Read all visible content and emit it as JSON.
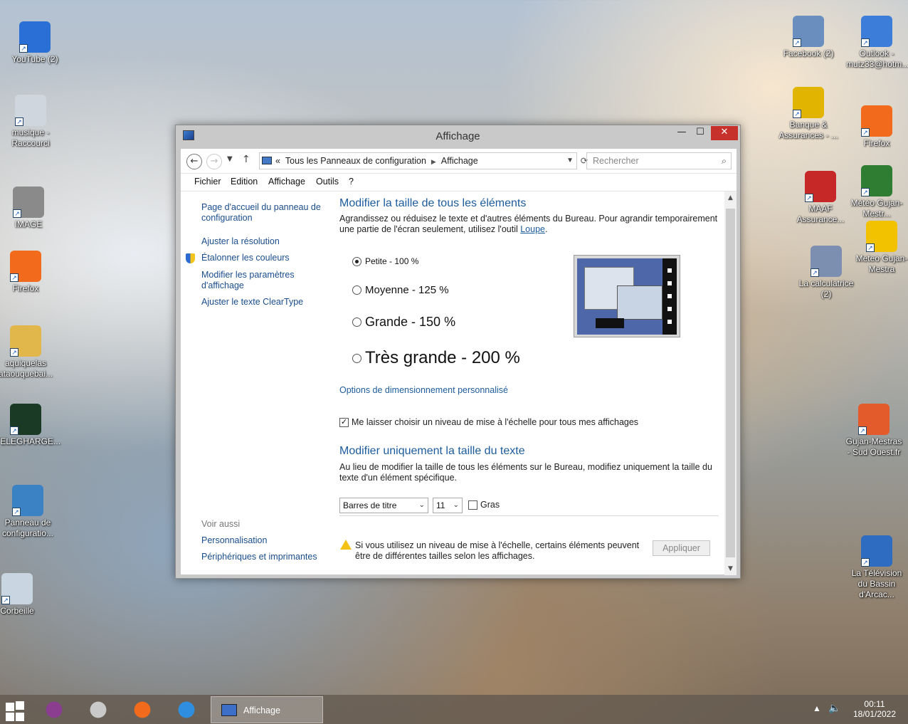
{
  "desktop": {
    "left_icons": [
      {
        "label": "YouTube (2)",
        "icon": "globe-icon",
        "color": "#2a6fd6"
      },
      {
        "label": "musique - Raccourci",
        "icon": "cd-icon",
        "color": "#cfd6de"
      },
      {
        "label": "IMAGE",
        "icon": "image-icon",
        "color": "#8a8a8a"
      },
      {
        "label": "Firefox",
        "icon": "firefox-icon",
        "color": "#f26a1b"
      },
      {
        "label": "aquiquelas ataouquebai...",
        "icon": "folder-user-icon",
        "color": "#e1b64a"
      },
      {
        "label": "TELEGHARGE...",
        "icon": "monitor-graph-icon",
        "color": "#1a3a25"
      },
      {
        "label": "Panneau de configuratio...",
        "icon": "control-panel-icon",
        "color": "#3b82c4"
      },
      {
        "label": "Corbeille",
        "icon": "recycle-bin-icon",
        "color": "#c9d6e2"
      }
    ],
    "right_icons": [
      {
        "label": "Facebook (2)",
        "icon": "people-icon",
        "color": "#6a8fbf"
      },
      {
        "label": "Outlook - mutz33@hotm...",
        "icon": "outlook-icon",
        "color": "#3b7dd8"
      },
      {
        "label": "Banque & Assurances - ...",
        "icon": "bank-icon",
        "color": "#e0b400"
      },
      {
        "label": "Firefox",
        "icon": "firefox-icon",
        "color": "#f26a1b"
      },
      {
        "label": "MAAF Assurance...",
        "icon": "maaf-icon",
        "color": "#c62828"
      },
      {
        "label": "Météo Gujan-Mestr...",
        "icon": "tree-icon",
        "color": "#2e7d32"
      },
      {
        "label": "La calculatrice (2)",
        "icon": "calculator-icon",
        "color": "#7d8fb0"
      },
      {
        "label": "Meteo Gujan-Mestra",
        "icon": "star-icon",
        "color": "#f2c200"
      },
      {
        "label": "Gujan-Mestras - Sud Ouest.fr",
        "icon": "house-icon",
        "color": "#e35b2b"
      },
      {
        "label": "La Télévision du Bassin d'Arcac...",
        "icon": "tv-icon",
        "color": "#2d6cc0"
      }
    ]
  },
  "window": {
    "title": "Affichage",
    "min_label": "—",
    "max_label": "☐",
    "close_label": "✕",
    "breadcrumb_prefix": "«",
    "breadcrumb": [
      "Tous les Panneaux de configuration",
      "Affichage"
    ],
    "search_placeholder": "Rechercher",
    "menu": [
      "Fichier",
      "Edition",
      "Affichage",
      "Outils",
      "?"
    ],
    "sidebar": {
      "links": [
        "Page d'accueil du panneau de configuration",
        "Ajuster la résolution",
        "Étalonner les couleurs",
        "Modifier les paramètres d'affichage",
        "Ajuster le texte ClearType"
      ],
      "see_also": "Voir aussi",
      "see_also_links": [
        "Personnalisation",
        "Périphériques et imprimantes"
      ]
    },
    "main": {
      "heading1": "Modifier la taille de tous les éléments",
      "desc1": "Agrandissez ou réduisez le texte et d'autres éléments du Bureau. Pour agrandir temporairement une partie de l'écran seulement, utilisez l'outil",
      "desc1_link": "Loupe",
      "desc1_end": ".",
      "options": [
        {
          "label": "Petite - 100 %",
          "checked": true
        },
        {
          "label": "Moyenne - 125 %",
          "checked": false
        },
        {
          "label": "Grande - 150 %",
          "checked": false
        },
        {
          "label": "Très grande - 200 %",
          "checked": false
        }
      ],
      "custom_link": "Options de dimensionnement personnalisé",
      "scale_checkbox": {
        "label": "Me laisser choisir un niveau de mise à l'échelle pour tous mes affichages",
        "checked": true
      },
      "heading2": "Modifier uniquement la taille du texte",
      "desc2": "Au lieu de modifier la taille de tous les éléments sur le Bureau, modifiez uniquement la taille du texte d'un élément spécifique.",
      "element_select": "Barres de titre",
      "size_select": "11",
      "bold_label": "Gras",
      "bold_checked": false,
      "warning": "Si vous utilisez un niveau de mise à l'échelle, certains éléments peuvent être de différentes tailles selon les affichages.",
      "apply_label": "Appliquer"
    }
  },
  "taskbar": {
    "active_task": "Affichage",
    "pinned": [
      {
        "icon": "calculator-icon",
        "color": "#8b3d8f"
      },
      {
        "icon": "satellite-icon",
        "color": "#c9c9c9"
      },
      {
        "icon": "firefox-icon",
        "color": "#f26a1b"
      },
      {
        "icon": "internet-explorer-icon",
        "color": "#2f8ee0"
      }
    ],
    "time": "00:11",
    "date": "18/01/2022"
  }
}
